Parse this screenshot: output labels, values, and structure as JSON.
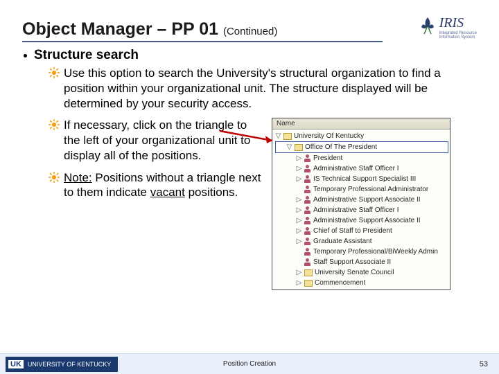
{
  "header": {
    "title_main": "Object Manager – PP 01",
    "title_cont": "(Continued)",
    "logo_text": "IRIS",
    "logo_sub1": "Integrated Resource",
    "logo_sub2": "Information System"
  },
  "content": {
    "heading": "Structure search",
    "b1": "Use this option to search the University's structural organization to find a position within your organizational unit.  The structure displayed will be determined by your security access.",
    "b2": "If necessary, click on the triangle to the left of your organizational unit to display all of the positions.",
    "b3_note": "Note:",
    "b3_rest": "  Positions without a triangle next to them indicate ",
    "b3_vacant": "vacant",
    "b3_end": " positions."
  },
  "tree": {
    "header": "Name",
    "items": [
      {
        "indent": 0,
        "tw": "▽",
        "icon": "fold",
        "label": "University Of Kentucky"
      },
      {
        "indent": 1,
        "tw": "▽",
        "icon": "fold",
        "label": "Office Of The President",
        "highlight": true
      },
      {
        "indent": 2,
        "tw": "▷",
        "icon": "pers",
        "label": "President"
      },
      {
        "indent": 2,
        "tw": "▷",
        "icon": "pers",
        "label": "Administrative Staff Officer I"
      },
      {
        "indent": 2,
        "tw": "▷",
        "icon": "pers",
        "label": "IS Technical Support Specialist III"
      },
      {
        "indent": 2,
        "tw": "",
        "icon": "pers",
        "label": "Temporary Professional Administrator"
      },
      {
        "indent": 2,
        "tw": "▷",
        "icon": "pers",
        "label": "Administrative Support Associate II"
      },
      {
        "indent": 2,
        "tw": "▷",
        "icon": "pers",
        "label": "Administrative Staff Officer I"
      },
      {
        "indent": 2,
        "tw": "▷",
        "icon": "pers",
        "label": "Administrative Support Associate II"
      },
      {
        "indent": 2,
        "tw": "▷",
        "icon": "pers",
        "label": "Chief of Staff to President"
      },
      {
        "indent": 2,
        "tw": "▷",
        "icon": "pers",
        "label": "Graduate Assistant"
      },
      {
        "indent": 2,
        "tw": "",
        "icon": "pers",
        "label": "Temporary Professional/BiWeekly Admin"
      },
      {
        "indent": 2,
        "tw": "",
        "icon": "pers",
        "label": "Staff Support Associate II"
      },
      {
        "indent": 2,
        "tw": "▷",
        "icon": "fold",
        "label": "University Senate Council"
      },
      {
        "indent": 2,
        "tw": "▷",
        "icon": "fold",
        "label": "Commencement"
      }
    ]
  },
  "footer": {
    "uk_abbrev": "UK",
    "uk_name": "UNIVERSITY OF KENTUCKY",
    "center": "Position Creation",
    "page": "53"
  }
}
